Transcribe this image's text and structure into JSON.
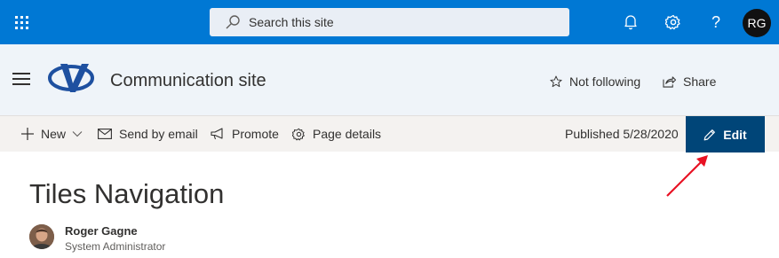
{
  "suite_bar": {
    "search": {
      "placeholder": "Search this site"
    },
    "user_initials": "RG",
    "icons": [
      "waffle-icon",
      "search-icon",
      "bell-icon",
      "gear-icon",
      "help-icon"
    ]
  },
  "site_header": {
    "title": "Communication site",
    "follow_label": "Not following",
    "share_label": "Share"
  },
  "command_bar": {
    "new_label": "New",
    "send_email_label": "Send by email",
    "promote_label": "Promote",
    "page_details_label": "Page details",
    "published_label": "Published 5/28/2020",
    "edit_label": "Edit"
  },
  "page": {
    "title": "Tiles Navigation",
    "author": {
      "name": "Roger Gagne",
      "role": "System Administrator"
    }
  },
  "colors": {
    "suite_bar": "#0078d4",
    "header_bg": "#eff4f9",
    "command_bar_bg": "#f4f2f0",
    "edit_button": "#004578",
    "annotation_arrow": "#e81123"
  }
}
